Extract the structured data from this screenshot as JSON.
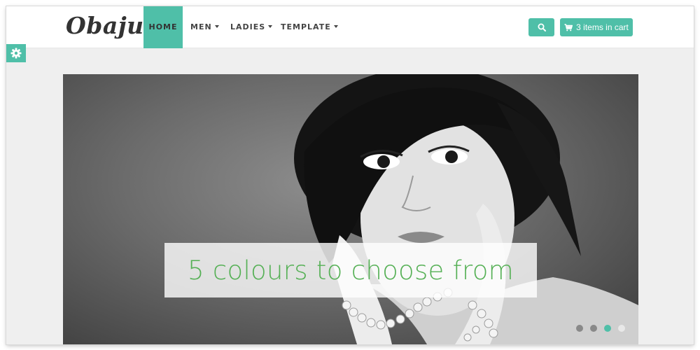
{
  "brand": {
    "logo_text": "Obaju"
  },
  "nav": {
    "items": [
      {
        "label": "HOME",
        "active": true,
        "has_dropdown": false
      },
      {
        "label": "MEN",
        "active": false,
        "has_dropdown": true
      },
      {
        "label": "LADIES",
        "active": false,
        "has_dropdown": true
      },
      {
        "label": "TEMPLATE",
        "active": false,
        "has_dropdown": true
      }
    ]
  },
  "header_actions": {
    "search_icon": "search-icon",
    "cart_icon": "shopping-cart-icon",
    "cart_label": "3 items in cart"
  },
  "settings": {
    "icon": "gear-icon"
  },
  "slider": {
    "caption": "5 colours to choose from",
    "dot_count": 4,
    "active_dot_index": 2
  },
  "colors": {
    "accent": "#4fbfa8",
    "caption_text": "#55b055",
    "page_background": "#efefef",
    "header_background": "#ffffff"
  }
}
